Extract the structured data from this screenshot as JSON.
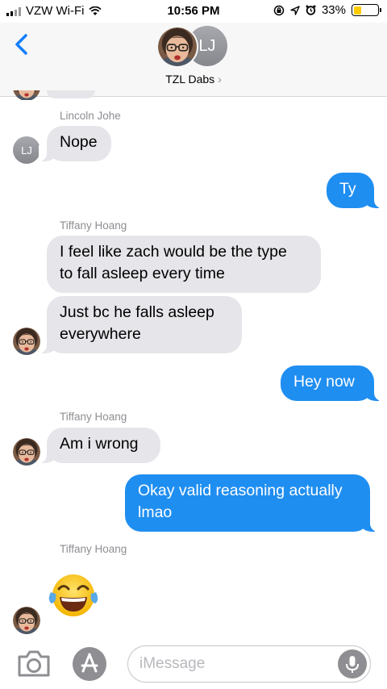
{
  "status_bar": {
    "carrier": "VZW Wi-Fi",
    "time": "10:56 PM",
    "battery": "33%",
    "battery_level": 0.33,
    "icons": [
      "signal-bars-icon",
      "wifi-icon",
      "screen-rotation-lock-icon",
      "location-arrow-icon",
      "alarm-icon",
      "battery-icon"
    ]
  },
  "header": {
    "group_name": "TZL Dabs",
    "chevron": "›",
    "avatar_initials": "LJ"
  },
  "messages": [
    {
      "sender": "Lincoln Johe",
      "avatar": "LJ",
      "text": "Nope",
      "direction": "incoming"
    },
    {
      "text": "Ty",
      "direction": "outgoing"
    },
    {
      "sender": "Tiffany Hoang",
      "lines": [
        "I feel like zach would be the type",
        "to fall asleep every time"
      ],
      "direction": "incoming"
    },
    {
      "lines": [
        "Just bc he falls asleep",
        "everywhere"
      ],
      "direction": "incoming"
    },
    {
      "text": "Hey now",
      "direction": "outgoing"
    },
    {
      "sender": "Tiffany Hoang",
      "text": "Am i wrong",
      "direction": "incoming"
    },
    {
      "lines": [
        "Okay valid reasoning actually",
        "lmao"
      ],
      "direction": "outgoing"
    },
    {
      "sender": "Tiffany Hoang",
      "emoji": "face-with-tears-of-joy",
      "direction": "incoming"
    }
  ],
  "composer": {
    "placeholder": "iMessage",
    "value": ""
  },
  "colors": {
    "outgoing_bubble": "#1f8ef1",
    "incoming_bubble": "#e5e5ea",
    "accent": "#147efb",
    "battery_fill": "#ffcc00"
  }
}
